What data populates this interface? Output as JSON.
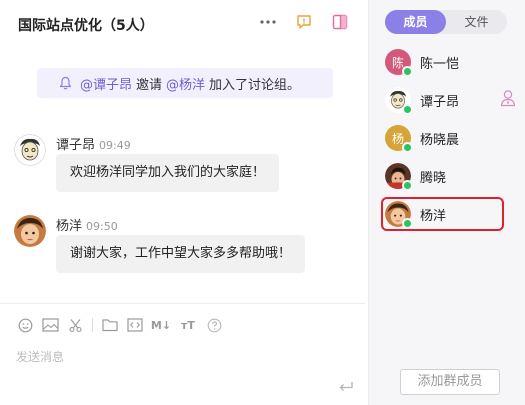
{
  "header": {
    "title": "国际站点优化（5人）"
  },
  "notice": {
    "inviter": "@谭子昂",
    "action": "邀请",
    "invitee": "@杨洋",
    "suffix": "加入了讨论组。"
  },
  "messages": [
    {
      "name": "谭子昂",
      "time": "09:49",
      "text": "欢迎杨洋同学加入我们的大家庭！"
    },
    {
      "name": "杨洋",
      "time": "09:50",
      "text": "谢谢大家，工作中望大家多多帮助哦！"
    }
  ],
  "composer": {
    "placeholder": "发送消息",
    "tools": [
      "emoji-icon",
      "image-icon",
      "scissors-icon",
      "folder-icon",
      "code-icon",
      "markdown-icon",
      "text-size-icon",
      "help-icon"
    ],
    "markdown_label": "M↓",
    "text_size_label": "тT"
  },
  "panel": {
    "tabs": [
      "成员",
      "文件"
    ],
    "active_tab": "成员",
    "members": [
      {
        "name": "陈一恺",
        "initial": "陈",
        "color": "#d4587a",
        "online": true
      },
      {
        "name": "谭子昂",
        "initial": "",
        "color": "#ffffff",
        "online": true
      },
      {
        "name": "杨晓晨",
        "initial": "杨",
        "color": "#d7a43a",
        "online": true
      },
      {
        "name": "腾晓",
        "initial": "",
        "color": "#7a4a35",
        "online": true
      },
      {
        "name": "杨洋",
        "initial": "",
        "color": "#b9703e",
        "online": true
      }
    ],
    "add_member_label": "添加群成员"
  },
  "colors": {
    "accent": "#8b7fe8",
    "online": "#2bc460",
    "selected_border": "#e0202a",
    "mention": "#6a5fd6"
  }
}
